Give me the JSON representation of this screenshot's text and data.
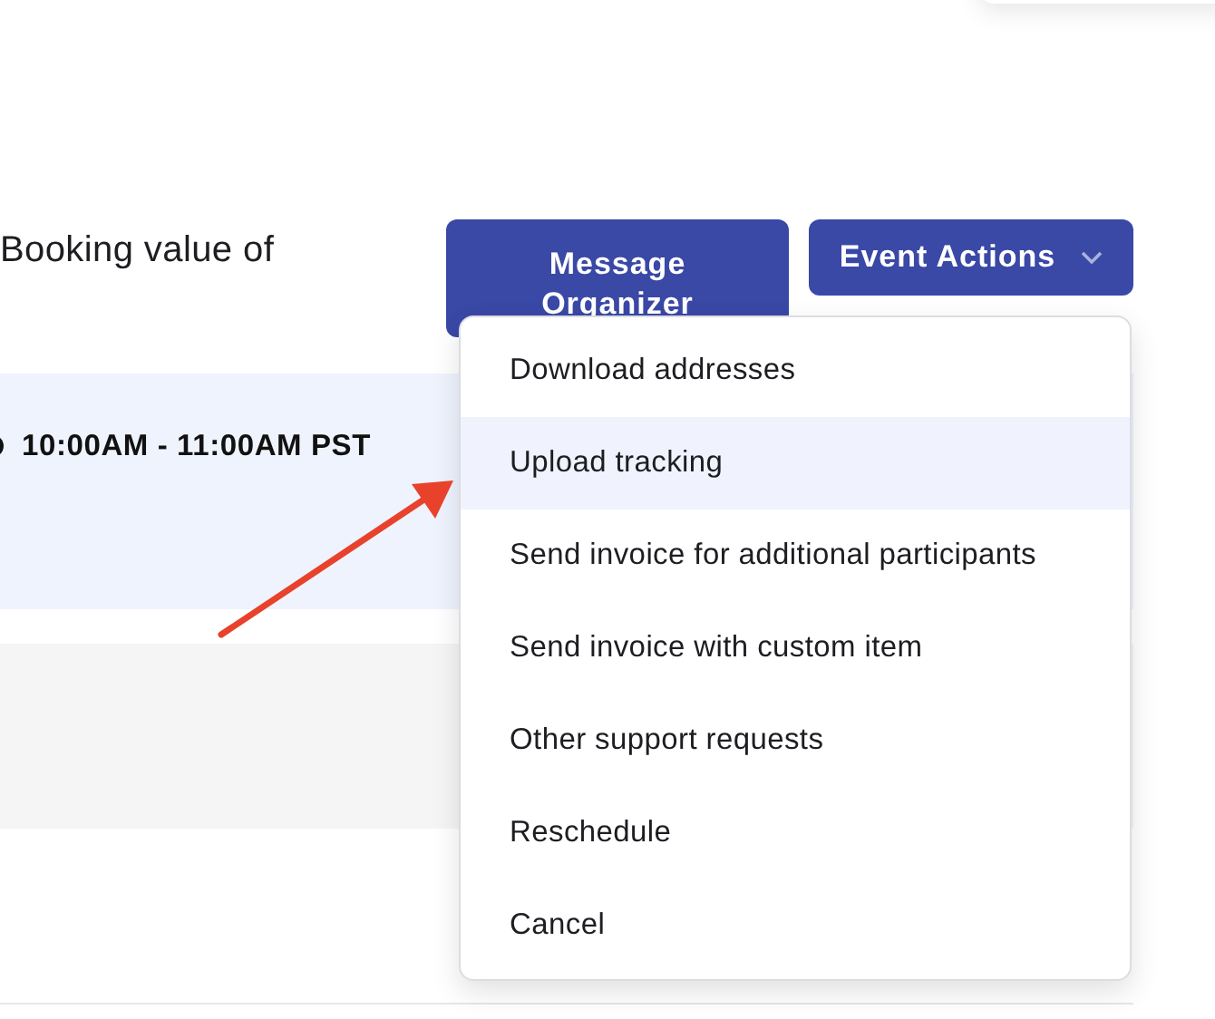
{
  "summary_text": "Booking value of",
  "buttons": [
    {
      "label": "Message Organizer",
      "kind": "plain"
    },
    {
      "label": "Event Actions",
      "kind": "dropdown"
    }
  ],
  "event": {
    "time": "10:00AM - 11:00AM PST"
  },
  "menu": {
    "items": [
      {
        "label": "Download addresses",
        "selected": false
      },
      {
        "label": "Upload tracking",
        "selected": true
      },
      {
        "label": "Send invoice for additional participants",
        "selected": false
      },
      {
        "label": "Send invoice with custom item",
        "selected": false
      },
      {
        "label": "Other support requests",
        "selected": false
      },
      {
        "label": "Reschedule",
        "selected": false
      },
      {
        "label": "Cancel",
        "selected": false
      }
    ]
  }
}
